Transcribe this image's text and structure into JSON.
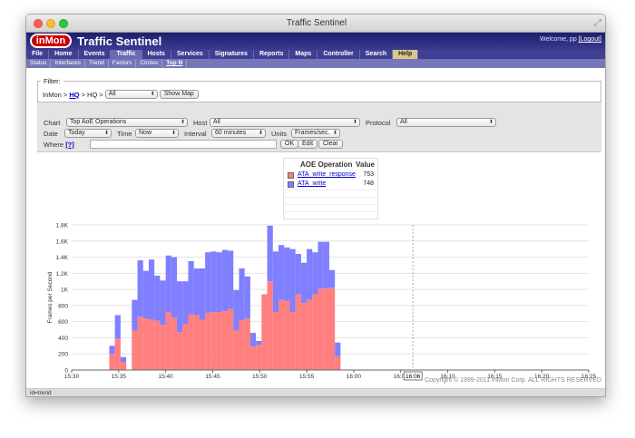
{
  "window": {
    "title": "Traffic Sentinel"
  },
  "header": {
    "logo": "inMon",
    "app_title": "Traffic Sentinel",
    "welcome": "Welcome, pp",
    "logout": "[Logout]"
  },
  "menu": [
    "File",
    "Home",
    "Events",
    "Traffic",
    "Hosts",
    "Services",
    "Signatures",
    "Reports",
    "Maps",
    "Controller",
    "Search",
    "Help"
  ],
  "submenu": [
    "Status",
    "Interfaces",
    "Trend",
    "Factors",
    "Circles",
    "Top N"
  ],
  "filter": {
    "legend": "Filter:",
    "crumb_prefix": "InMon >",
    "crumb_link": "HQ",
    "crumb_suffix": "> HQ >",
    "scope": "All",
    "show_map": "Show Map"
  },
  "controls": {
    "chart_label": "Chart",
    "chart_value": "Top AoE Operations",
    "host_label": "Host",
    "host_value": "All",
    "protocol_label": "Protocol",
    "protocol_value": "All",
    "date_label": "Date",
    "date_value": "Today",
    "time_label": "Time",
    "time_value": "Now",
    "interval_label": "Interval",
    "interval_value": "60 minutes",
    "units_label": "Units",
    "units_value": "Frames/sec.",
    "where_label": "Where",
    "where_help": "[?]",
    "where_value": "",
    "ok": "OK",
    "edit": "Edit",
    "clear": "Clear"
  },
  "legend_table": {
    "col_op": "AOE Operation",
    "col_val": "Value",
    "rows": [
      {
        "name": "ATA_write_response",
        "value": "753",
        "color": "#ff7f7f"
      },
      {
        "name": "ATA_write",
        "value": "748",
        "color": "#7f7fff"
      }
    ]
  },
  "chart_data": {
    "type": "bar",
    "stacked": true,
    "ylabel": "Frames per Second",
    "ylim": [
      0,
      1800
    ],
    "yticks": [
      "0",
      "200",
      "400",
      "600",
      "800",
      "1K",
      "1.2K",
      "1.4K",
      "1.6K",
      "1.8K"
    ],
    "xticks": [
      {
        "label": "15:30",
        "t": 30
      },
      {
        "label": "15:35",
        "t": 35
      },
      {
        "label": "15:40",
        "t": 40
      },
      {
        "label": "15:45",
        "t": 45
      },
      {
        "label": "15:50",
        "t": 50
      },
      {
        "label": "15:55",
        "t": 55
      },
      {
        "label": "16:00",
        "t": 60
      },
      {
        "label": "16:05",
        "t": 65
      },
      {
        "label": "16:10",
        "t": 70
      },
      {
        "label": "16:15",
        "t": 75
      },
      {
        "label": "16:20",
        "t": 80
      },
      {
        "label": "16:25",
        "t": 85
      }
    ],
    "cursor_label": "16:06",
    "x_start": 30,
    "x_end": 85,
    "bar_start": 34,
    "bar_step": 0.6,
    "series": [
      {
        "name": "ATA_write_response",
        "color": "#ff7f7f",
        "values": [
          200,
          390,
          100,
          0,
          490,
          660,
          640,
          630,
          610,
          560,
          720,
          650,
          470,
          570,
          690,
          680,
          620,
          710,
          720,
          720,
          730,
          760,
          490,
          620,
          640,
          290,
          310,
          940,
          1100,
          720,
          870,
          860,
          720,
          940,
          830,
          870,
          940,
          1010,
          1010,
          1020,
          170
        ]
      },
      {
        "name": "ATA_write",
        "color": "#7f7fff",
        "values": [
          100,
          290,
          60,
          0,
          380,
          700,
          590,
          740,
          560,
          550,
          700,
          750,
          630,
          530,
          660,
          580,
          640,
          750,
          750,
          740,
          760,
          720,
          500,
          640,
          520,
          170,
          50,
          0,
          690,
          750,
          680,
          660,
          780,
          500,
          500,
          630,
          520,
          580,
          580,
          220,
          170
        ]
      }
    ]
  },
  "footer": {
    "copyright": "Copyright © 1999-2011 InMon Corp. ALL RIGHTS RESERVED",
    "status": "id=trend"
  }
}
